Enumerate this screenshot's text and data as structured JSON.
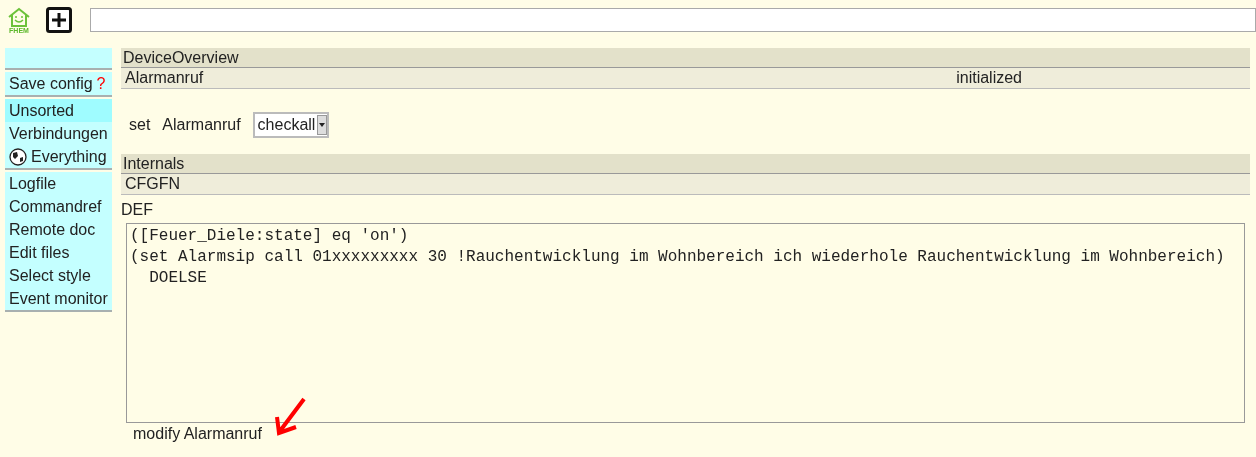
{
  "logo": {
    "text": "FHEM"
  },
  "command_field": {
    "kind": "input"
  },
  "sidebar": {
    "groups": [
      {
        "items": [
          {
            "kind": "blank",
            "selected": false
          }
        ]
      },
      {
        "items": [
          {
            "kind": "save",
            "label": "Save config",
            "marker": "?",
            "selected": false
          }
        ]
      },
      {
        "items": [
          {
            "kind": "link",
            "label": "Unsorted",
            "selected": true
          },
          {
            "kind": "link",
            "label": "Verbindungen",
            "selected": false
          },
          {
            "kind": "globe",
            "label": "Everything",
            "selected": false
          }
        ]
      },
      {
        "items": [
          {
            "kind": "link",
            "label": "Logfile",
            "selected": false
          },
          {
            "kind": "link",
            "label": "Commandref",
            "selected": false
          },
          {
            "kind": "link",
            "label": "Remote doc",
            "selected": false
          },
          {
            "kind": "link",
            "label": "Edit files",
            "selected": false
          },
          {
            "kind": "link",
            "label": "Select style",
            "selected": false
          },
          {
            "kind": "link",
            "label": "Event monitor",
            "selected": false
          }
        ]
      }
    ]
  },
  "device_overview": {
    "title": "DeviceOverview",
    "device": "Alarmanruf",
    "state": "initialized"
  },
  "set_row": {
    "label": "set",
    "device": "Alarmanruf",
    "select_value": "checkall"
  },
  "internals": {
    "title": "Internals",
    "rows": [
      "CFGFN"
    ]
  },
  "def": {
    "label": "DEF",
    "lines": [
      "([Feuer_Diele:state] eq 'on')",
      "(set Alarmsip call 01xxxxxxxxx 30 !Rauchentwicklung im Wohnbereich ich wiederhole Rauchentwicklung im Wohnbereich)",
      "  DOELSE"
    ]
  },
  "modify_link": "modify Alarmanruf"
}
